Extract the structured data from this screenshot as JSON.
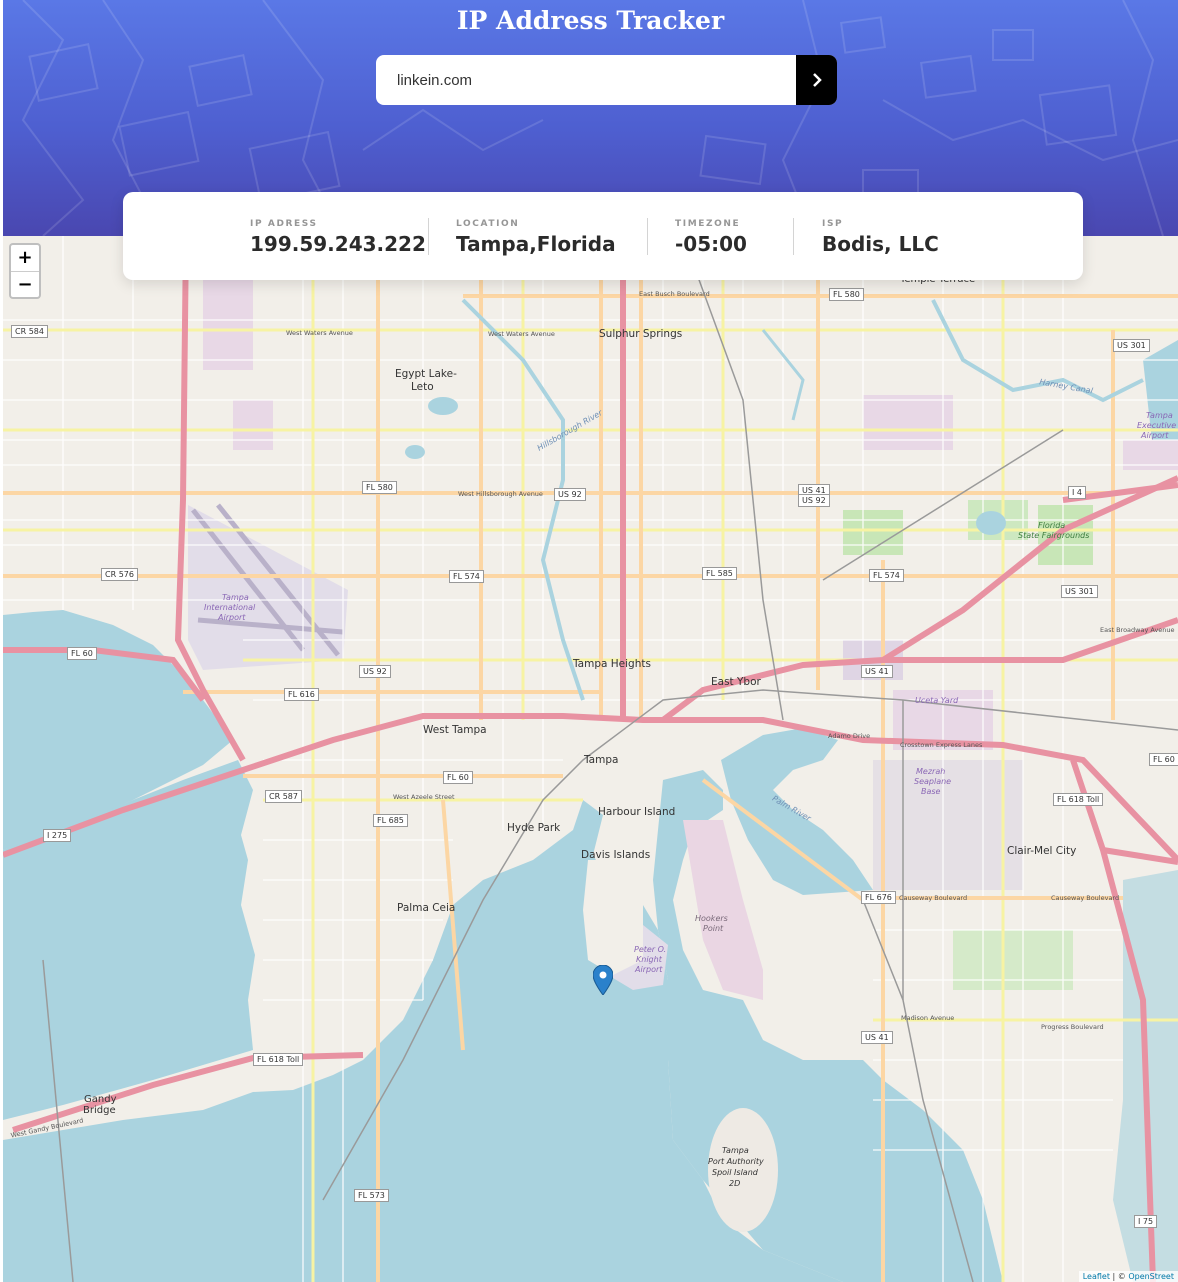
{
  "app": {
    "title": "IP Address Tracker"
  },
  "search": {
    "value": "linkein.com"
  },
  "info": {
    "ip": {
      "label": "IP ADRESS",
      "value": "199.59.243.222"
    },
    "location": {
      "label": "LOCATION",
      "value": "Tampa,Florida"
    },
    "timezone": {
      "label": "TIMEZONE",
      "value": "-05:00"
    },
    "isp": {
      "label": "ISP",
      "value": "Bodis, LLC"
    }
  },
  "map": {
    "zoom_in": "+",
    "zoom_out": "−",
    "attribution": {
      "leaflet": "Leaflet",
      "separator": " | © ",
      "osm": "OpenStreet"
    },
    "places": {
      "sulphur_springs": "Sulphur Springs",
      "egypt_lake": "Egypt Lake-",
      "egypt_lake_2": "Leto",
      "temple_terrace": "Temple Terrace",
      "tampa_heights": "Tampa Heights",
      "east_ybor": "East Ybor",
      "west_tampa": "West Tampa",
      "tampa": "Tampa",
      "harbour_island": "Harbour Island",
      "hyde_park": "Hyde Park",
      "davis_islands": "Davis Islands",
      "palma_ceia": "Palma Ceia",
      "clair_mel": "Clair-Mel City",
      "gandy": "Gandy",
      "gandy_2": "Bridge",
      "ybor_yard": "Uceta Yard",
      "hookers": "Hookers",
      "hookers_2": "Point",
      "spoil": "Tampa",
      "spoil_2": "Port Authority",
      "spoil_3": "Spoil Island",
      "spoil_4": "2D"
    },
    "airports": {
      "tia_1": "Tampa",
      "tia_2": "International",
      "tia_3": "Airport",
      "exec_1": "Tampa",
      "exec_2": "Executive",
      "exec_3": "Airport",
      "knight_1": "Peter O.",
      "knight_2": "Knight",
      "knight_3": "Airport",
      "mezrah_1": "Mezrah",
      "mezrah_2": "Seaplane",
      "mezrah_3": "Base",
      "fair_1": "Florida",
      "fair_2": "State Fairgrounds"
    },
    "shields": {
      "fl580a": "FL 580",
      "fl580b": "FL 580",
      "us92a": "US 92",
      "us41a": "US 41",
      "us92b": "US 92",
      "us301a": "US 301",
      "us301b": "US 301",
      "cr584": "CR 584",
      "cr576": "CR 576",
      "fl574a": "FL 574",
      "fl585": "FL 585",
      "fl574b": "FL 574",
      "fl60a": "FL 60",
      "us92c": "US 92",
      "fl616": "FL 616",
      "us41b": "US 41",
      "fl60b": "FL 60",
      "cr587": "CR 587",
      "fl685": "FL 685",
      "i275": "I 275",
      "fl618": "FL 618 Toll",
      "fl618b": "FL 618 Toll",
      "fl676": "FL 676",
      "us41c": "US 41",
      "fl573": "FL 573",
      "fl60c": "FL 60",
      "i4": "I 4",
      "i75": "I 75"
    },
    "streets": {
      "west_waters": "West Waters Avenue",
      "west_waters2": "West Waters Avenue",
      "east_busch": "East Busch Boulevard",
      "west_hillsborough": "West Hillsborough Avenue",
      "west_azeele": "West Azeele Street",
      "causeway": "Causeway Boulevard",
      "causeway2": "Causeway Boulevard",
      "madison": "Madison Avenue",
      "progress": "Progress Boulevard",
      "adamo": "Adamo Drive",
      "east_broadway": "East Broadway Avenue",
      "west_gandy": "West Gandy Boulevard",
      "crosstown": "Crosstown Express Lanes"
    },
    "water": {
      "hillsborough_river": "Hillsborough River",
      "palm_river": "Palm River",
      "harney": "Harney Canal"
    }
  }
}
